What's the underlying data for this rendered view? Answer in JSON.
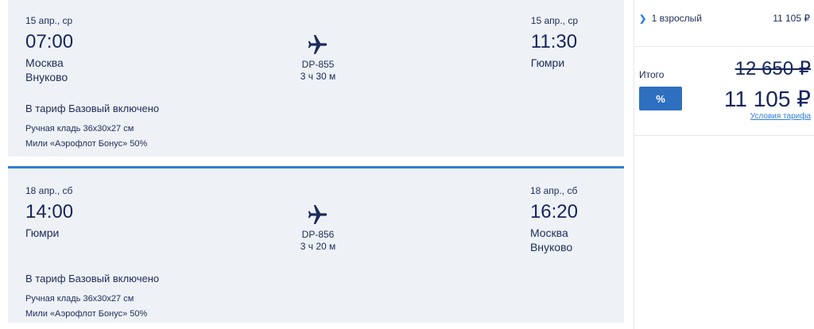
{
  "flights": [
    {
      "departure": {
        "date": "15 апр., ср",
        "time": "07:00",
        "city": "Москва",
        "airport": "Внуково"
      },
      "arrival": {
        "date": "15 апр., ср",
        "time": "11:30",
        "city": "Гюмри",
        "airport": ""
      },
      "flight_number": "DP-855",
      "duration": "3 ч 30 м",
      "tariff_title": "В тариф Базовый включено",
      "tariff_items": [
        "Ручная кладь 36х30х27 см",
        "Мили «Аэрофлот Бонус» 50%"
      ]
    },
    {
      "departure": {
        "date": "18 апр., сб",
        "time": "14:00",
        "city": "Гюмри",
        "airport": ""
      },
      "arrival": {
        "date": "18 апр., сб",
        "time": "16:20",
        "city": "Москва",
        "airport": "Внуково"
      },
      "flight_number": "DP-856",
      "duration": "3 ч 20 м",
      "tariff_title": "В тариф Базовый включено",
      "tariff_items": [
        "Ручная кладь 36х30х27 см",
        "Мили «Аэрофлот Бонус» 50%"
      ]
    }
  ],
  "summary": {
    "passengers_label": "1 взрослый",
    "passengers_price": "11 105 ₽",
    "total_label": "Итого",
    "old_price": "12 650 ₽",
    "promo_button": "%",
    "new_price": "11 105 ₽",
    "tariff_link": "Условия тарифа"
  },
  "colors": {
    "card_bg": "#eef2f6",
    "accent": "#2f7ed8",
    "text": "#1c2b5a",
    "button": "#2e6fc0"
  },
  "icons": {
    "plane": "plane-icon",
    "chevron": "chevron-right-icon"
  }
}
